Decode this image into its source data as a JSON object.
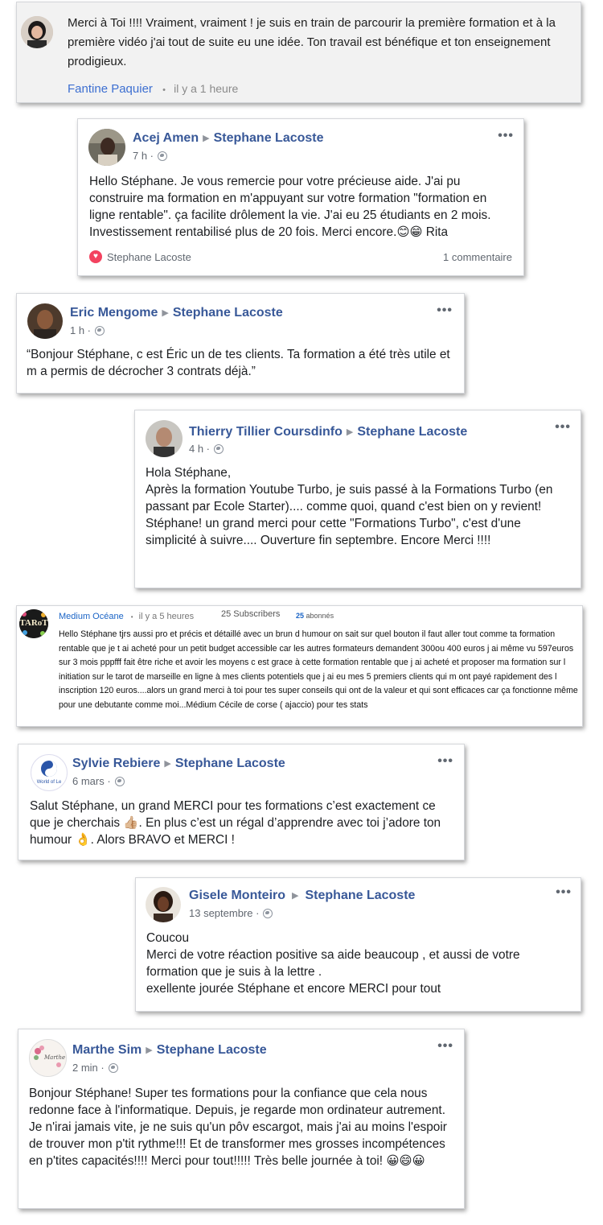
{
  "comment1": {
    "text": "Merci à Toi !!!! Vraiment, vraiment ! je suis en train de parcourir la première formation et à la première vidéo j'ai tout de suite eu une idée. Ton travail est bénéfique et ton enseignement prodigieux.",
    "author": "Fantine Paquier",
    "separator": "•",
    "time": "il y a 1 heure"
  },
  "post1": {
    "author": "Acej Amen",
    "target": "Stephane Lacoste",
    "time": "7 h ·",
    "text": "Hello Stéphane. Je vous remercie pour votre précieuse aide. J'ai pu construire ma formation en m'appuyant sur votre formation \"formation en ligne rentable\". ça facilite drôlement la vie. J'ai eu 25 étudiants en 2 mois. Investissement rentabilisé plus de 20 fois. Merci encore.😊😁 Rita",
    "reaction_name": "Stephane Lacoste",
    "comment_count": "1 commentaire",
    "menu": "•••"
  },
  "post2": {
    "author": "Eric Mengome",
    "target": "Stephane Lacoste",
    "time": "1 h ·",
    "text": "“Bonjour Stéphane, c est Éric un de tes clients. Ta formation a été très utile et m a permis de décrocher 3 contrats déjà.”",
    "menu": "•••"
  },
  "post3": {
    "author": "Thierry Tillier Coursdinfo",
    "target": "Stephane Lacoste",
    "time": "4 h ·",
    "lines": [
      "Hola Stéphane,",
      "Après la formation Youtube Turbo, je suis passé à la Formations Turbo (en passant par Ecole Starter).... comme quoi, quand c'est bien on y revient!",
      "Stéphane! un grand merci pour cette \"Formations Turbo\", c'est d'une simplicité à suivre.... Ouverture fin septembre. Encore Merci !!!!"
    ],
    "menu": "•••"
  },
  "comment2": {
    "author": "Medium Océane",
    "separator": "•",
    "time": "il y a 5 heures",
    "subscribers": "25 Subscribers",
    "abonnes_count": "25",
    "abonnes_label": "abonnés",
    "avatar_text": "TARoT",
    "text": "Hello Stéphane tjrs aussi pro et précis et détaillé avec un brun d humour on sait sur quel bouton il faut aller tout comme ta formation rentable que je t ai  acheté  pour un petit budget accessible  car les autres formateurs  demandent  300ou 400 euros j ai même vu 597euros sur 3 mois  pppfff  fait être riche et avoir les moyens  c est grace à cette formation rentable que j ai acheté et proposer ma formation  sur l initiation  sur le tarot de marseille en ligne  à mes clients potentiels que j ai eu  mes 5 premiers clients  qui m ont payé rapidement des l inscription  120 euros....alors un grand merci à toi pour tes super conseils  qui ont de la valeur et qui sont efficaces car ça fonctionne même pour une debutante comme moi...Médium Cécile de corse  ( ajaccio) pour tes stats"
  },
  "post4": {
    "author": "Sylvie Rebiere",
    "target": "Stephane Lacoste",
    "time": "6 mars ·",
    "text": "Salut Stéphane, un grand MERCI pour tes formations c’est exactement ce que je cherchais 👍🏼. En plus c’est un régal d’apprendre avec toi j’adore ton humour 👌. Alors BRAVO et MERCI !",
    "avatar_text": "World of Le",
    "menu": "•••"
  },
  "post5": {
    "author": "Gisele Monteiro",
    "target": "Stephane Lacoste",
    "time": "13 septembre ·",
    "lines": [
      "Coucou",
      "Merci de votre réaction positive sa aide beaucoup , et aussi de votre formation que je suis à la lettre .",
      "exellente jourée Stéphane et encore MERCI pour tout"
    ],
    "menu": "•••"
  },
  "post6": {
    "author": "Marthe Sim",
    "target": "Stephane Lacoste",
    "time": "2 min ·",
    "text": "Bonjour Stéphane! Super tes formations pour la confiance que cela nous redonne face à l'informatique. Depuis, je regarde mon ordinateur autrement. Je n'irai jamais vite, je ne suis qu'un pôv escargot, mais j'ai au moins l'espoir de trouver mon p'tit rythme!!! Et de transformer mes grosses incompétences en p'tites capacités!!!! Merci pour tout!!!!! Très belle journée à toi! 😀😄😀",
    "avatar_text": "Marthe",
    "menu": "•••"
  }
}
